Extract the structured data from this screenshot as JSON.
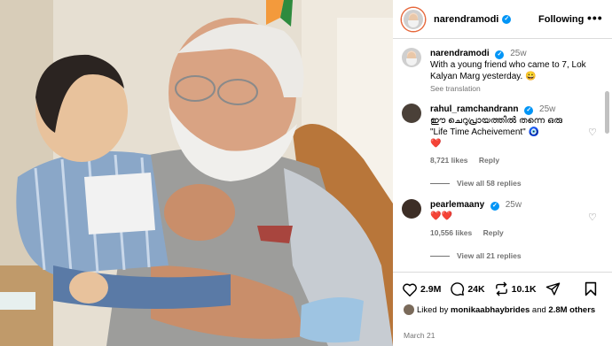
{
  "header": {
    "username": "narendramodi",
    "follow_label": "Following",
    "more_icon": "more-horizontal-icon"
  },
  "caption": {
    "username": "narendramodi",
    "time": "25w",
    "text": "With a young friend who came to 7, Lok Kalyan Marg yesterday. 😀",
    "see_translation": "See translation"
  },
  "comments": [
    {
      "username": "rahul_ramchandrann",
      "time": "25w",
      "text": "ഈ ചെറുപ്രായത്തിൽ തന്നെ ഒരു \"Life Time Acheivement\" 🧿",
      "emoji_line": "❤️",
      "likes": "8,721 likes",
      "reply": "Reply",
      "view_replies": "View all 58 replies"
    },
    {
      "username": "pearlemaany",
      "time": "25w",
      "text": "❤️❤️",
      "likes": "10,556 likes",
      "reply": "Reply",
      "view_replies": "View all 21 replies"
    }
  ],
  "actions": {
    "likes_count": "2.9M",
    "comments_count": "24K",
    "reposts_count": "10.1K"
  },
  "liked_by": {
    "prefix": "Liked by",
    "user": "monikaabhaybrides",
    "suffix": "and",
    "others": "2.8M others"
  },
  "date": "March 21"
}
